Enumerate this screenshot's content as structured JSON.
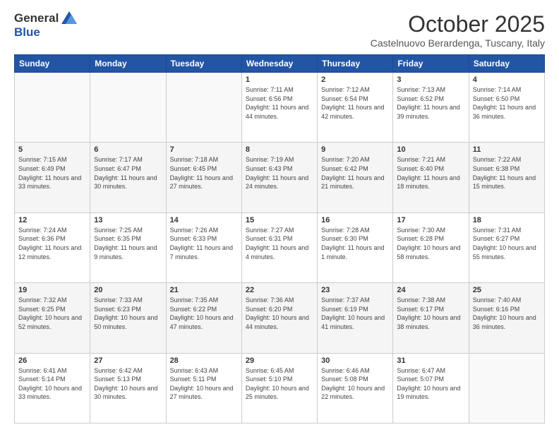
{
  "logo": {
    "general": "General",
    "blue": "Blue"
  },
  "title": "October 2025",
  "subtitle": "Castelnuovo Berardenga, Tuscany, Italy",
  "days_header": [
    "Sunday",
    "Monday",
    "Tuesday",
    "Wednesday",
    "Thursday",
    "Friday",
    "Saturday"
  ],
  "weeks": [
    [
      {
        "day": "",
        "info": ""
      },
      {
        "day": "",
        "info": ""
      },
      {
        "day": "",
        "info": ""
      },
      {
        "day": "1",
        "info": "Sunrise: 7:11 AM\nSunset: 6:56 PM\nDaylight: 11 hours and 44 minutes."
      },
      {
        "day": "2",
        "info": "Sunrise: 7:12 AM\nSunset: 6:54 PM\nDaylight: 11 hours and 42 minutes."
      },
      {
        "day": "3",
        "info": "Sunrise: 7:13 AM\nSunset: 6:52 PM\nDaylight: 11 hours and 39 minutes."
      },
      {
        "day": "4",
        "info": "Sunrise: 7:14 AM\nSunset: 6:50 PM\nDaylight: 11 hours and 36 minutes."
      }
    ],
    [
      {
        "day": "5",
        "info": "Sunrise: 7:15 AM\nSunset: 6:49 PM\nDaylight: 11 hours and 33 minutes."
      },
      {
        "day": "6",
        "info": "Sunrise: 7:17 AM\nSunset: 6:47 PM\nDaylight: 11 hours and 30 minutes."
      },
      {
        "day": "7",
        "info": "Sunrise: 7:18 AM\nSunset: 6:45 PM\nDaylight: 11 hours and 27 minutes."
      },
      {
        "day": "8",
        "info": "Sunrise: 7:19 AM\nSunset: 6:43 PM\nDaylight: 11 hours and 24 minutes."
      },
      {
        "day": "9",
        "info": "Sunrise: 7:20 AM\nSunset: 6:42 PM\nDaylight: 11 hours and 21 minutes."
      },
      {
        "day": "10",
        "info": "Sunrise: 7:21 AM\nSunset: 6:40 PM\nDaylight: 11 hours and 18 minutes."
      },
      {
        "day": "11",
        "info": "Sunrise: 7:22 AM\nSunset: 6:38 PM\nDaylight: 11 hours and 15 minutes."
      }
    ],
    [
      {
        "day": "12",
        "info": "Sunrise: 7:24 AM\nSunset: 6:36 PM\nDaylight: 11 hours and 12 minutes."
      },
      {
        "day": "13",
        "info": "Sunrise: 7:25 AM\nSunset: 6:35 PM\nDaylight: 11 hours and 9 minutes."
      },
      {
        "day": "14",
        "info": "Sunrise: 7:26 AM\nSunset: 6:33 PM\nDaylight: 11 hours and 7 minutes."
      },
      {
        "day": "15",
        "info": "Sunrise: 7:27 AM\nSunset: 6:31 PM\nDaylight: 11 hours and 4 minutes."
      },
      {
        "day": "16",
        "info": "Sunrise: 7:28 AM\nSunset: 6:30 PM\nDaylight: 11 hours and 1 minute."
      },
      {
        "day": "17",
        "info": "Sunrise: 7:30 AM\nSunset: 6:28 PM\nDaylight: 10 hours and 58 minutes."
      },
      {
        "day": "18",
        "info": "Sunrise: 7:31 AM\nSunset: 6:27 PM\nDaylight: 10 hours and 55 minutes."
      }
    ],
    [
      {
        "day": "19",
        "info": "Sunrise: 7:32 AM\nSunset: 6:25 PM\nDaylight: 10 hours and 52 minutes."
      },
      {
        "day": "20",
        "info": "Sunrise: 7:33 AM\nSunset: 6:23 PM\nDaylight: 10 hours and 50 minutes."
      },
      {
        "day": "21",
        "info": "Sunrise: 7:35 AM\nSunset: 6:22 PM\nDaylight: 10 hours and 47 minutes."
      },
      {
        "day": "22",
        "info": "Sunrise: 7:36 AM\nSunset: 6:20 PM\nDaylight: 10 hours and 44 minutes."
      },
      {
        "day": "23",
        "info": "Sunrise: 7:37 AM\nSunset: 6:19 PM\nDaylight: 10 hours and 41 minutes."
      },
      {
        "day": "24",
        "info": "Sunrise: 7:38 AM\nSunset: 6:17 PM\nDaylight: 10 hours and 38 minutes."
      },
      {
        "day": "25",
        "info": "Sunrise: 7:40 AM\nSunset: 6:16 PM\nDaylight: 10 hours and 36 minutes."
      }
    ],
    [
      {
        "day": "26",
        "info": "Sunrise: 6:41 AM\nSunset: 5:14 PM\nDaylight: 10 hours and 33 minutes."
      },
      {
        "day": "27",
        "info": "Sunrise: 6:42 AM\nSunset: 5:13 PM\nDaylight: 10 hours and 30 minutes."
      },
      {
        "day": "28",
        "info": "Sunrise: 6:43 AM\nSunset: 5:11 PM\nDaylight: 10 hours and 27 minutes."
      },
      {
        "day": "29",
        "info": "Sunrise: 6:45 AM\nSunset: 5:10 PM\nDaylight: 10 hours and 25 minutes."
      },
      {
        "day": "30",
        "info": "Sunrise: 6:46 AM\nSunset: 5:08 PM\nDaylight: 10 hours and 22 minutes."
      },
      {
        "day": "31",
        "info": "Sunrise: 6:47 AM\nSunset: 5:07 PM\nDaylight: 10 hours and 19 minutes."
      },
      {
        "day": "",
        "info": ""
      }
    ]
  ]
}
